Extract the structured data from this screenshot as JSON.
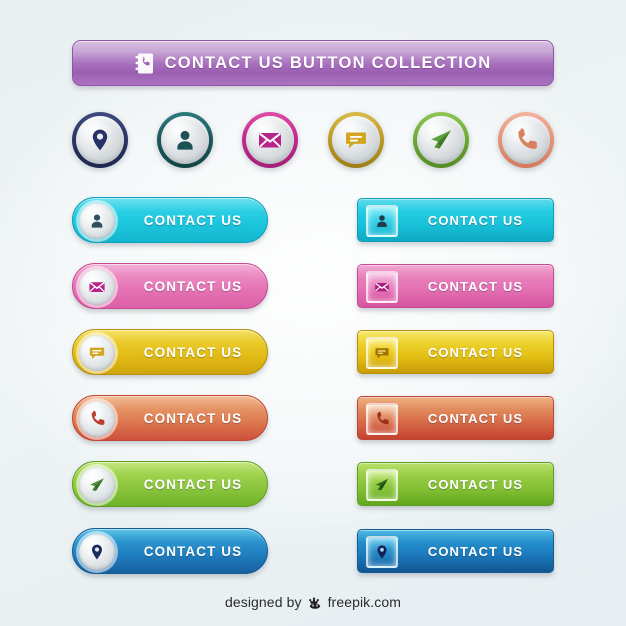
{
  "background_color": "#eaf1f3",
  "header": {
    "title": "CONTACT US BUTTON COLLECTION",
    "icon": "contact-book-icon",
    "gradient_top": "#d9c2e3",
    "gradient_bottom": "#ab74c1",
    "border_color": "#8e56a5",
    "text_color": "#ffffff"
  },
  "circle_icons": [
    {
      "name": "location-pin-icon",
      "ring_color": "#2b3566",
      "glyph_color": "#273166",
      "label": "Location"
    },
    {
      "name": "person-icon",
      "ring_color": "#1d5b5e",
      "glyph_color": "#1d5255",
      "label": "Person"
    },
    {
      "name": "envelope-icon",
      "ring_color": "#c42a8e",
      "glyph_color": "#b8258a",
      "label": "Email"
    },
    {
      "name": "chat-bubble-icon",
      "ring_color": "#bd9b24",
      "glyph_color": "#d3a520",
      "label": "Chat"
    },
    {
      "name": "paper-plane-icon",
      "ring_color": "#6cab34",
      "glyph_color": "#4f9030",
      "label": "Send"
    },
    {
      "name": "phone-icon",
      "ring_color": "#e8947a",
      "glyph_color": "#d9805f",
      "label": "Phone"
    }
  ],
  "buttons": {
    "label": "CONTACT US",
    "rows": [
      {
        "color_name": "cyan",
        "icon": "person-icon",
        "glyph_color": "#2f4f63",
        "pill_gradient_top": "#6fe0ee",
        "pill_gradient_mid": "#1cc6dd",
        "pill_gradient_bottom": "#14b6cf",
        "border_color": "#0f9fb8",
        "badge_top": "#8ef0fb",
        "badge_bottom": "#0fb8d2"
      },
      {
        "color_name": "pink",
        "icon": "envelope-icon",
        "glyph_color": "#b8258a",
        "pill_gradient_top": "#f0a3ce",
        "pill_gradient_mid": "#e573b4",
        "pill_gradient_bottom": "#dd5fa7",
        "border_color": "#c74b92",
        "badge_top": "#f7c4e2",
        "badge_bottom": "#d8539f"
      },
      {
        "color_name": "gold",
        "icon": "chat-bubble-icon",
        "glyph_color": "#b07e0e",
        "pill_gradient_top": "#f3de57",
        "pill_gradient_mid": "#e2bc16",
        "pill_gradient_bottom": "#cfa40c",
        "border_color": "#b5900a",
        "badge_top": "#fbef86",
        "badge_bottom": "#d4a70c"
      },
      {
        "color_name": "orange",
        "icon": "phone-icon",
        "glyph_color": "#b8402c",
        "pill_gradient_top": "#f0b287",
        "pill_gradient_mid": "#e08055",
        "pill_gradient_bottom": "#cf4f3c",
        "border_color": "#bf4634",
        "badge_top": "#fadcc0",
        "badge_bottom": "#c94b37"
      },
      {
        "color_name": "green",
        "icon": "paper-plane-icon",
        "glyph_color": "#2f6b22",
        "pill_gradient_top": "#b6dc63",
        "pill_gradient_mid": "#8cc63f",
        "pill_gradient_bottom": "#6fb229",
        "border_color": "#5e9e22",
        "badge_top": "#d6ef9a",
        "badge_bottom": "#6eb129"
      },
      {
        "color_name": "blue",
        "icon": "location-pin-icon",
        "glyph_color": "#1b2b63",
        "pill_gradient_top": "#49b6e0",
        "pill_gradient_mid": "#1f7fc0",
        "pill_gradient_bottom": "#17609f",
        "border_color": "#145a94",
        "badge_top": "#6fd0f2",
        "badge_bottom": "#1668a8"
      }
    ]
  },
  "footer": {
    "prefix": "designed by",
    "brand": "freepik.com",
    "logo": "crown-icon",
    "text_color": "#2b2b2b"
  }
}
